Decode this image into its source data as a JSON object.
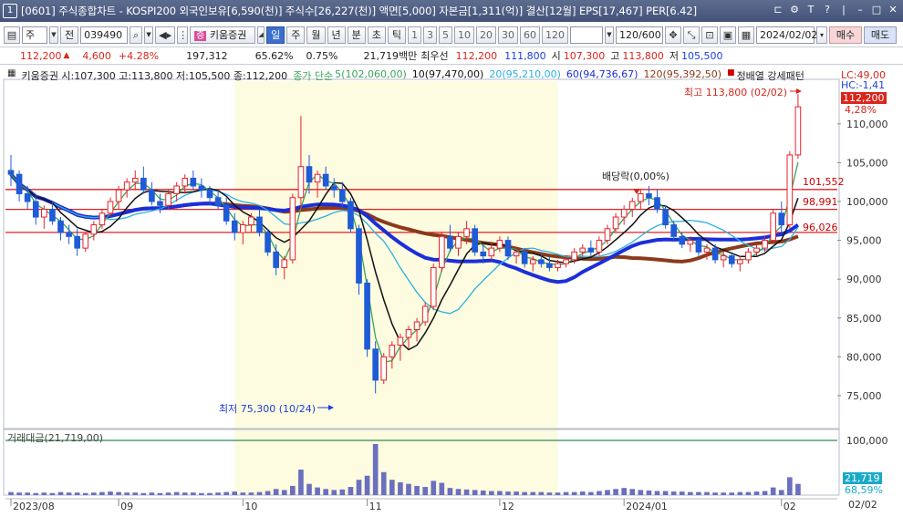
{
  "window": {
    "number": "1",
    "title": "[0601] 주식종합차트 - KOSPI200 외국인보유[6,590(천)] 주식수[26,227(천)] 액면[5,000] 자본금[1,311(억)] 결산[12월] EPS[17,467] PER[6.42]"
  },
  "toolbar": {
    "period_select": "주",
    "prev_label": "전",
    "stock_code": "039490",
    "stock_name": "키움증권",
    "tabs": [
      "일",
      "주",
      "월",
      "년",
      "분",
      "초",
      "틱"
    ],
    "active_tab": "일",
    "intervals": [
      "1",
      "3",
      "5",
      "10",
      "20",
      "30",
      "60",
      "120"
    ],
    "count": "120/600",
    "date": "2024/02/02",
    "buy_label": "매수",
    "sell_label": "매도"
  },
  "quote": {
    "price": "112,200",
    "change": "4,600",
    "change_pct": "+4.28%",
    "volume": "197,312",
    "vol_ratio": "65.62%",
    "turnover": "0.75%",
    "amount": "21,719백만",
    "best_label": "최우선",
    "ask": "112,200",
    "bid": "111,800",
    "open_label": "시",
    "open": "107,300",
    "high_label": "고",
    "high": "113,800",
    "low_label": "저",
    "low": "105,500"
  },
  "legend": {
    "ohlc": "키움증권 시:107,300 고:113,800 저:105,500 종:112,200",
    "ma_label": "종가 단순",
    "ma5": "5(102,060,00)",
    "ma10": "10(97,470,00)",
    "ma20": "20(95,210,00)",
    "ma60": "60(94,736,67)",
    "ma120": "120(95,392,50)",
    "pattern": "정배열 강세패턴"
  },
  "annotations": {
    "high": "최고 113,800 (02/02)",
    "low": "최저 75,300 (10/24)",
    "ex_dividend": "배당락(0,00%)",
    "lc": "LC:49,00",
    "hc": "HC:-1,41",
    "last_price_box": "112,200",
    "last_pct": "4,28%",
    "line1": "101,552",
    "line2": "98,991",
    "line3": "96,026",
    "volume_title": "거래대금(21,719,00)",
    "volume_box": "21,719",
    "volume_pct": "68,59%"
  },
  "colors": {
    "up": "#e8202a",
    "down": "#1f5bd6",
    "ma5": "#3aa35b",
    "ma10": "#111111",
    "ma20": "#2bb0e0",
    "ma60": "#1b2fd8",
    "ma120": "#8b3a1a",
    "highlight": "#fdfbe0"
  },
  "chart_data": {
    "type": "candlestick",
    "y_ticks": [
      "110,000",
      "105,000",
      "100,000",
      "95,000",
      "90,000",
      "85,000",
      "80,000",
      "75,000"
    ],
    "volume_ticks": [
      "100,000"
    ],
    "x_ticks": [
      "2023/08",
      "09",
      "10",
      "11",
      "12",
      "2024/01",
      "02"
    ],
    "x_end": "02/02",
    "ylim": [
      71000,
      115500
    ],
    "ohlc": [
      [
        104000,
        106000,
        102000,
        103500
      ],
      [
        103500,
        104000,
        100000,
        101000
      ],
      [
        101000,
        102000,
        99000,
        100000
      ],
      [
        100000,
        101000,
        97000,
        98000
      ],
      [
        98000,
        99500,
        96500,
        99000
      ],
      [
        99000,
        100000,
        97000,
        97500
      ],
      [
        97500,
        98000,
        95000,
        96000
      ],
      [
        96000,
        97000,
        94500,
        95500
      ],
      [
        95500,
        96500,
        93000,
        94000
      ],
      [
        94000,
        96000,
        93500,
        95800
      ],
      [
        95800,
        97500,
        95000,
        97000
      ],
      [
        97000,
        99000,
        96500,
        98500
      ],
      [
        98500,
        100500,
        98000,
        100000
      ],
      [
        100000,
        102000,
        99000,
        101500
      ],
      [
        101500,
        103000,
        100500,
        102500
      ],
      [
        102500,
        104000,
        101500,
        103000
      ],
      [
        103000,
        104500,
        101000,
        101500
      ],
      [
        101500,
        102500,
        99500,
        100000
      ],
      [
        100000,
        101000,
        98500,
        99500
      ],
      [
        99500,
        101500,
        99000,
        101000
      ],
      [
        101000,
        102500,
        100000,
        102000
      ],
      [
        102000,
        103500,
        101000,
        103000
      ],
      [
        103000,
        104000,
        101500,
        102000
      ],
      [
        102000,
        103000,
        100500,
        101500
      ],
      [
        101500,
        102000,
        99500,
        100500
      ],
      [
        100500,
        101500,
        99000,
        99500
      ],
      [
        99500,
        100500,
        97000,
        97500
      ],
      [
        97500,
        98500,
        95000,
        96000
      ],
      [
        96000,
        97500,
        94500,
        97000
      ],
      [
        97000,
        98500,
        96000,
        98000
      ],
      [
        98000,
        99000,
        95500,
        96000
      ],
      [
        96000,
        96500,
        93000,
        93500
      ],
      [
        93500,
        94500,
        90500,
        91500
      ],
      [
        91500,
        93000,
        90000,
        92500
      ],
      [
        92500,
        101000,
        92000,
        100500
      ],
      [
        100500,
        111000,
        99000,
        104500
      ],
      [
        104500,
        106000,
        101000,
        102500
      ],
      [
        102500,
        104000,
        100500,
        103500
      ],
      [
        103500,
        104500,
        101500,
        102000
      ],
      [
        102000,
        103000,
        100500,
        101500
      ],
      [
        101500,
        102500,
        99000,
        100000
      ],
      [
        100000,
        100500,
        96000,
        96500
      ],
      [
        96500,
        97000,
        88000,
        89500
      ],
      [
        89500,
        90000,
        80000,
        81000
      ],
      [
        81000,
        82000,
        75300,
        77000
      ],
      [
        77000,
        80500,
        76500,
        80000
      ],
      [
        80000,
        82000,
        78500,
        81500
      ],
      [
        81500,
        83000,
        79500,
        82500
      ],
      [
        82500,
        84000,
        81000,
        83500
      ],
      [
        83500,
        85000,
        82000,
        84500
      ],
      [
        84500,
        87000,
        84000,
        86500
      ],
      [
        86500,
        92000,
        86000,
        91500
      ],
      [
        91500,
        96000,
        91000,
        95500
      ],
      [
        95500,
        97000,
        93500,
        94000
      ],
      [
        94000,
        96000,
        93000,
        95500
      ],
      [
        95500,
        97500,
        94500,
        96500
      ],
      [
        96500,
        97000,
        93000,
        93500
      ],
      [
        93500,
        94500,
        92000,
        93000
      ],
      [
        93000,
        94500,
        92500,
        94000
      ],
      [
        94000,
        95500,
        93500,
        95000
      ],
      [
        95000,
        95500,
        92500,
        93000
      ],
      [
        93000,
        94000,
        92000,
        93500
      ],
      [
        93500,
        94000,
        91500,
        92000
      ],
      [
        92000,
        93000,
        91000,
        92500
      ],
      [
        92500,
        93500,
        91500,
        92000
      ],
      [
        92000,
        93000,
        91000,
        91500
      ],
      [
        91500,
        92500,
        91000,
        92000
      ],
      [
        92000,
        93000,
        91500,
        92500
      ],
      [
        92500,
        94000,
        92000,
        93500
      ],
      [
        93500,
        94500,
        93000,
        94000
      ],
      [
        94000,
        95000,
        93000,
        93500
      ],
      [
        93500,
        95500,
        93000,
        95000
      ],
      [
        95000,
        97000,
        94500,
        96500
      ],
      [
        96500,
        98500,
        96000,
        98000
      ],
      [
        98000,
        99500,
        97000,
        99000
      ],
      [
        99000,
        100500,
        98000,
        100000
      ],
      [
        100000,
        101500,
        99000,
        101000
      ],
      [
        101000,
        102000,
        99500,
        100500
      ],
      [
        100500,
        101500,
        98500,
        99000
      ],
      [
        99000,
        99500,
        96500,
        97000
      ],
      [
        97000,
        97500,
        95000,
        95500
      ],
      [
        95500,
        96000,
        94000,
        94500
      ],
      [
        94500,
        95500,
        93500,
        95000
      ],
      [
        95000,
        95500,
        93000,
        93500
      ],
      [
        93500,
        94500,
        92500,
        94000
      ],
      [
        94000,
        94500,
        92000,
        92500
      ],
      [
        92500,
        93500,
        91500,
        93000
      ],
      [
        93000,
        93500,
        91500,
        92000
      ],
      [
        92000,
        93000,
        91000,
        92500
      ],
      [
        92500,
        94000,
        92000,
        93500
      ],
      [
        93500,
        94500,
        93000,
        94000
      ],
      [
        94000,
        95500,
        93500,
        95000
      ],
      [
        95000,
        99000,
        94500,
        98500
      ],
      [
        98500,
        100000,
        96000,
        97000
      ],
      [
        97000,
        106500,
        96500,
        106000
      ],
      [
        106000,
        113800,
        105500,
        112200
      ]
    ],
    "volume": [
      0.06,
      0.05,
      0.05,
      0.04,
      0.05,
      0.04,
      0.06,
      0.05,
      0.05,
      0.04,
      0.05,
      0.06,
      0.07,
      0.06,
      0.05,
      0.05,
      0.04,
      0.05,
      0.04,
      0.05,
      0.06,
      0.05,
      0.05,
      0.04,
      0.04,
      0.05,
      0.06,
      0.07,
      0.05,
      0.05,
      0.06,
      0.08,
      0.12,
      0.1,
      0.18,
      0.5,
      0.22,
      0.15,
      0.12,
      0.1,
      0.11,
      0.16,
      0.3,
      0.38,
      1.0,
      0.45,
      0.3,
      0.25,
      0.22,
      0.18,
      0.16,
      0.28,
      0.24,
      0.14,
      0.12,
      0.11,
      0.1,
      0.09,
      0.08,
      0.08,
      0.07,
      0.07,
      0.06,
      0.06,
      0.06,
      0.05,
      0.05,
      0.06,
      0.06,
      0.07,
      0.06,
      0.08,
      0.1,
      0.12,
      0.14,
      0.12,
      0.1,
      0.09,
      0.08,
      0.08,
      0.07,
      0.07,
      0.06,
      0.06,
      0.06,
      0.05,
      0.05,
      0.05,
      0.06,
      0.06,
      0.07,
      0.08,
      0.15,
      0.1,
      0.35,
      0.22
    ]
  }
}
